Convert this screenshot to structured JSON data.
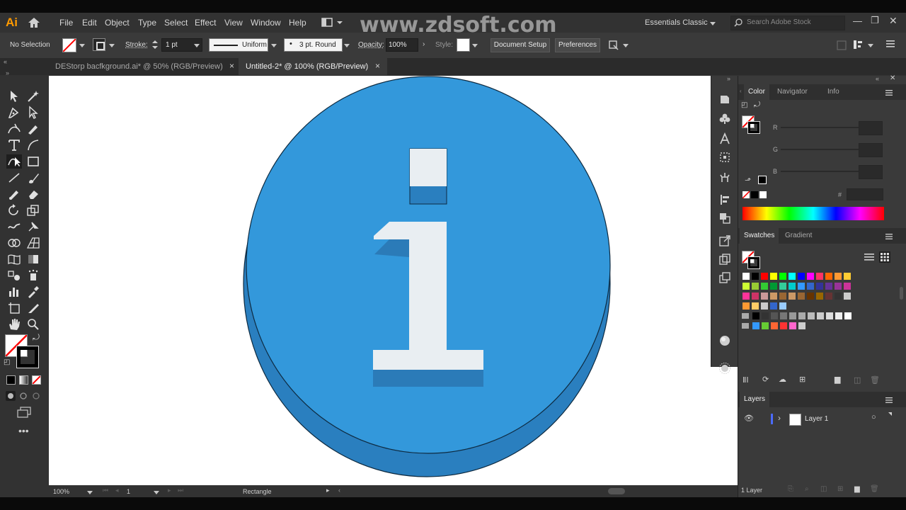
{
  "app": {
    "logo": "Ai",
    "workspace": "Essentials Classic",
    "stock_search_placeholder": "Search Adobe Stock"
  },
  "menu": [
    "File",
    "Edit",
    "Object",
    "Type",
    "Select",
    "Effect",
    "View",
    "Window",
    "Help"
  ],
  "watermark": "www.zdsoft.com",
  "control_bar": {
    "selection": "No Selection",
    "stroke_label": "Stroke:",
    "stroke_weight": "1 pt",
    "stroke_profile": "Uniform",
    "brush": "3 pt. Round",
    "opacity_label": "Opacity:",
    "opacity_value": "100%",
    "style_label": "Style:",
    "document_setup": "Document Setup",
    "preferences": "Preferences"
  },
  "tabs": [
    {
      "label": "DEStorp bacfkground.ai* @ 50% (RGB/Preview)",
      "close": "×"
    },
    {
      "label": "Untitled-2* @ 100% (RGB/Preview)",
      "close": "×"
    }
  ],
  "color_panel": {
    "tabs": [
      "Color",
      "Navigator",
      "Info"
    ],
    "channels": [
      "R",
      "G",
      "B"
    ],
    "hex_symbol": "#"
  },
  "swatches_panel": {
    "tabs": [
      "Swatches",
      "Gradient"
    ]
  },
  "layers_panel": {
    "title": "Layers",
    "layer_name": "Layer 1",
    "layer_count": "1 Layer"
  },
  "status_bar": {
    "zoom": "100%",
    "artboard": "1",
    "tool": "Rectangle"
  },
  "colors": {
    "icon_blue": "#3398db",
    "icon_side": "#2a7fbf",
    "icon_letter": "#e9eef2",
    "letter_shadow": "#2b7bb8"
  },
  "swatch_rows": [
    [
      "#ffffff",
      "#000000",
      "#ff0000",
      "#ffff00",
      "#00ff00",
      "#00ffff",
      "#0000ff",
      "#ff00ff",
      "#ff3366",
      "#ff6600",
      "#ff9933",
      "#ffcc33"
    ],
    [
      "#ccff33",
      "#99cc33",
      "#33cc33",
      "#009933",
      "#33cc99",
      "#00cccc",
      "#3399ff",
      "#3366cc",
      "#333399",
      "#663399",
      "#993399",
      "#cc3399"
    ],
    [
      "#ff3399",
      "#cc3366",
      "#cc9999",
      "#cc9966",
      "#996633",
      "#cc9966",
      "#996633",
      "#663300",
      "#996600",
      "#663333",
      "#333333",
      "#cccccc"
    ],
    [
      "#ff9933",
      "#ffcc66",
      "#cccccc",
      "#3366cc",
      "#99ccff"
    ],
    [
      "#000000",
      "#333333",
      "#555555",
      "#777777",
      "#999999",
      "#aaaaaa",
      "#bbbbbb",
      "#cccccc",
      "#dddddd",
      "#eeeeee",
      "#ffffff"
    ],
    [
      "#3399ff",
      "#66cc33",
      "#ff6633",
      "#ff3333",
      "#ff66cc",
      "#cccccc"
    ]
  ]
}
